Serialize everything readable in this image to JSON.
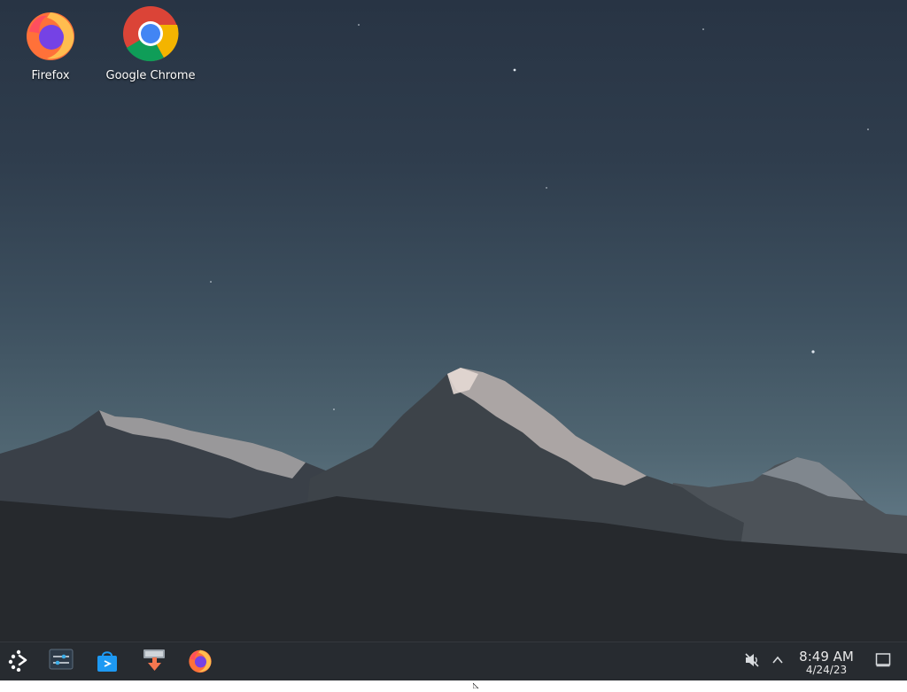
{
  "desktop": {
    "icons": [
      {
        "label": "Firefox",
        "icon": "firefox-icon"
      },
      {
        "label": "Google Chrome",
        "icon": "chrome-icon"
      }
    ]
  },
  "taskbar": {
    "launcher_icon": "application-launcher-icon",
    "pinned": [
      {
        "name": "System Settings",
        "icon": "system-settings-icon"
      },
      {
        "name": "Discover",
        "icon": "discover-store-icon"
      },
      {
        "name": "Install",
        "icon": "installer-icon"
      },
      {
        "name": "Firefox",
        "icon": "firefox-icon"
      }
    ],
    "tray": {
      "volume_icon": "volume-muted-icon",
      "expand_icon": "chevron-up-icon",
      "show_desktop_icon": "show-desktop-icon"
    },
    "clock": {
      "time": "8:49 AM",
      "date": "4/24/23"
    }
  },
  "colors": {
    "taskbar_bg": "#272b30",
    "sky_top": "#283444",
    "sky_horizon": "#5d7481"
  }
}
